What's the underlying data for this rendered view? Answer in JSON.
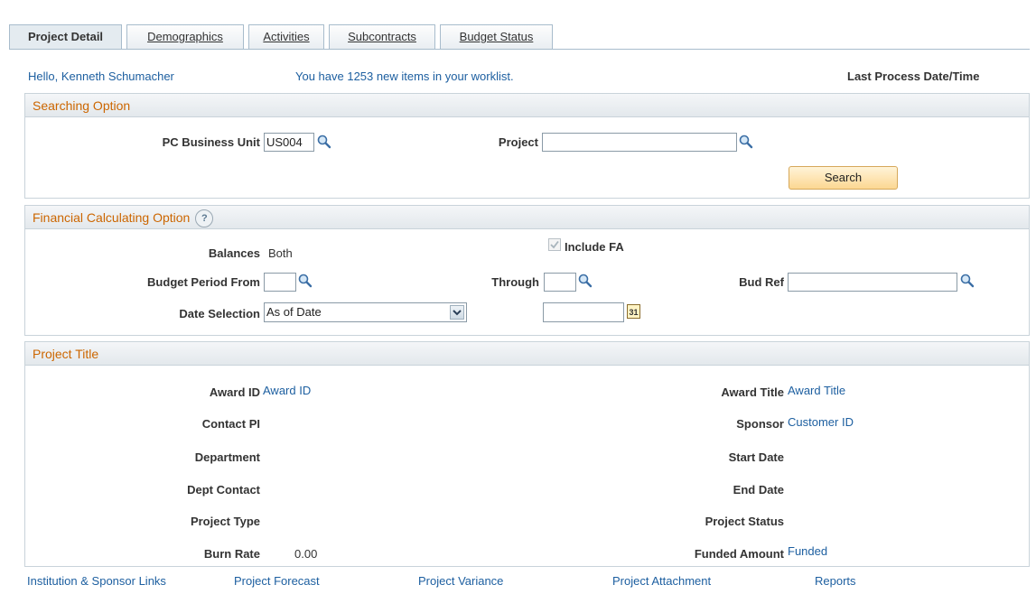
{
  "tabs": [
    {
      "label": "Project Detail",
      "active": true
    },
    {
      "label": "Demographics",
      "active": false
    },
    {
      "label": "Activities",
      "active": false
    },
    {
      "label": "Subcontracts",
      "active": false
    },
    {
      "label": "Budget Status",
      "active": false
    }
  ],
  "greeting": {
    "hello": "Hello, Kenneth  Schumacher",
    "worklist": "You have 1253 new items in your worklist.",
    "last_process": "Last Process Date/Time"
  },
  "searching": {
    "title": "Searching Option",
    "business_unit_label": "PC Business Unit",
    "business_unit_value": "US004",
    "project_label": "Project",
    "project_value": "",
    "search_button": "Search"
  },
  "financial": {
    "title": "Financial Calculating Option",
    "help_icon": "?",
    "balances_label": "Balances",
    "balances_value": "Both",
    "include_fa_label": "Include FA",
    "include_fa_checked": true,
    "budget_from_label": "Budget Period From",
    "budget_from_value": "",
    "through_label": "Through",
    "through_value": "",
    "bud_ref_label": "Bud Ref",
    "bud_ref_value": "",
    "date_selection_label": "Date Selection",
    "date_selection_value": "As of Date",
    "date_value": "",
    "calendar_icon_text": "31"
  },
  "project_title": {
    "title": "Project Title",
    "award_id_label": "Award ID",
    "award_id_value": "Award ID",
    "award_title_label": "Award Title",
    "award_title_value": "Award Title",
    "contact_pi_label": "Contact PI",
    "sponsor_label": "Sponsor",
    "sponsor_value": "Customer ID",
    "department_label": "Department",
    "start_date_label": "Start Date",
    "dept_contact_label": "Dept Contact",
    "end_date_label": "End Date",
    "project_type_label": "Project Type",
    "project_status_label": "Project Status",
    "burn_rate_label": "Burn Rate",
    "burn_rate_value": "0.00",
    "funded_amount_label": "Funded Amount",
    "funded_amount_value": "Funded"
  },
  "footer_links": [
    "Institution & Sponsor Links",
    "Project Forecast",
    "Project Variance",
    "Project Attachment",
    "Reports"
  ],
  "colors": {
    "accent_orange": "#cc6600",
    "link_blue": "#1d5fa0",
    "button_gold": "#fcd792"
  }
}
